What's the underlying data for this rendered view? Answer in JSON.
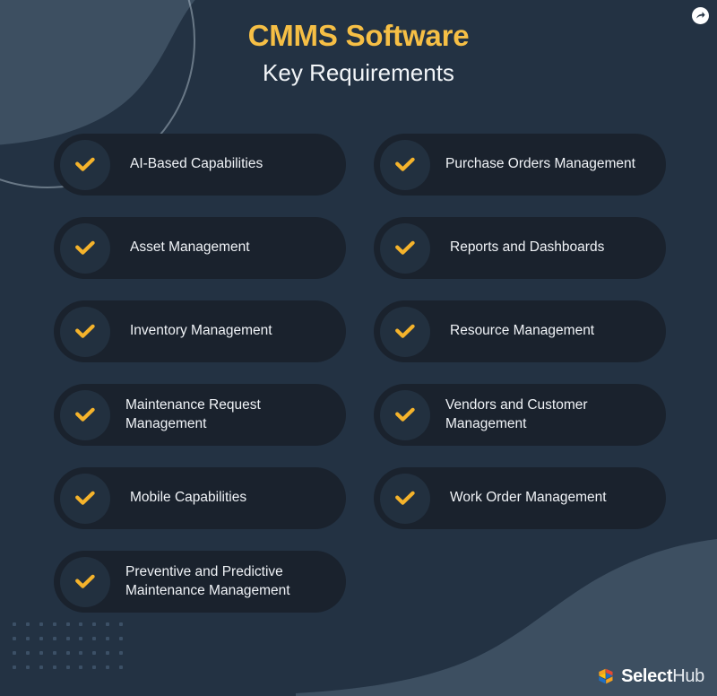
{
  "header": {
    "title": "CMMS Software",
    "subtitle": "Key Requirements",
    "title_color": "#f6bf45",
    "subtitle_color": "#f2f5f8"
  },
  "theme": {
    "page_background": "#233243",
    "pill_background": "#1a222d",
    "badge_background": "#22303f",
    "accent_yellow": "#f5b32b",
    "label_color": "#f0f3f7",
    "deco_slate": "#3d4f61",
    "dot_color": "#3c5066"
  },
  "share_badge": {
    "icon": "share-arrow-icon",
    "circle_color": "#ffffff",
    "glyph_color": "#233243"
  },
  "requirements": {
    "check_icon": "check-icon",
    "left_column": [
      {
        "label": "AI-Based Capabilities",
        "lines": 1
      },
      {
        "label": "Asset Management",
        "lines": 1
      },
      {
        "label": "Inventory Management",
        "lines": 1
      },
      {
        "label": "Maintenance Request Management",
        "lines": 2
      },
      {
        "label": "Mobile Capabilities",
        "lines": 1
      },
      {
        "label": "Preventive and Predictive Maintenance Management",
        "lines": 2
      }
    ],
    "right_column": [
      {
        "label": "Purchase Orders Management",
        "lines": 2
      },
      {
        "label": "Reports and Dashboards",
        "lines": 1
      },
      {
        "label": "Resource Management",
        "lines": 1
      },
      {
        "label": "Vendors and Customer Management",
        "lines": 2
      },
      {
        "label": "Work Order Management",
        "lines": 1
      }
    ],
    "total_count": 11
  },
  "logo": {
    "mark": "selecthub-cube-icon",
    "name_bold": "Select",
    "name_light": "Hub",
    "cube_colors": {
      "orange": "#f5a21e",
      "red": "#e8492f",
      "blue": "#1f6fc4",
      "yellow": "#fdc010"
    }
  }
}
